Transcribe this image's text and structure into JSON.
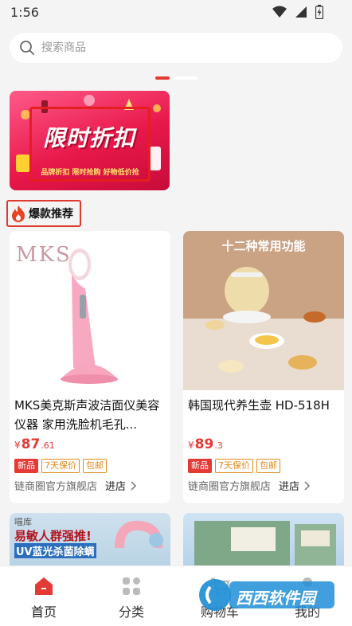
{
  "status": {
    "time": "1:56"
  },
  "search": {
    "placeholder": "搜索商品"
  },
  "banner": {
    "title": "限时折扣",
    "subtitle": "品牌折扣 限时抢购 好物低价抢"
  },
  "section": {
    "title": "爆款推荐"
  },
  "products": [
    {
      "brand": "MKS",
      "name": "MKS美克斯声波洁面仪美容仪器 家用洗脸机毛孔...",
      "price_symbol": "¥",
      "price_int": "87",
      "price_dec": ".61",
      "tags": [
        "新品",
        "7天保价",
        "包邮"
      ],
      "store": "链商圈官方旗舰店",
      "enter": "进店"
    },
    {
      "image_title": "十二种常用功能",
      "name": "韩国现代养生壶 HD-518H",
      "price_symbol": "¥",
      "price_int": "89",
      "price_dec": ".3",
      "tags": [
        "新品",
        "7天保价",
        "包邮"
      ],
      "store": "链商圈官方旗舰店",
      "enter": "进店"
    }
  ],
  "partial_cards": {
    "left": {
      "small": "喵库",
      "line1": "易敏人群强推!",
      "line2": "UV蓝光杀菌除螨"
    }
  },
  "tabs": [
    {
      "label": "首页",
      "icon": "home-icon",
      "active": true
    },
    {
      "label": "分类",
      "icon": "category-icon",
      "active": false
    },
    {
      "label": "购物车",
      "icon": "cart-icon",
      "active": false
    },
    {
      "label": "我的",
      "icon": "profile-icon",
      "active": false
    }
  ],
  "watermark": {
    "text": "西西软件园"
  },
  "colors": {
    "accent": "#e53935",
    "tag_outline": "#e08a1e",
    "background": "#f4f4f4"
  }
}
